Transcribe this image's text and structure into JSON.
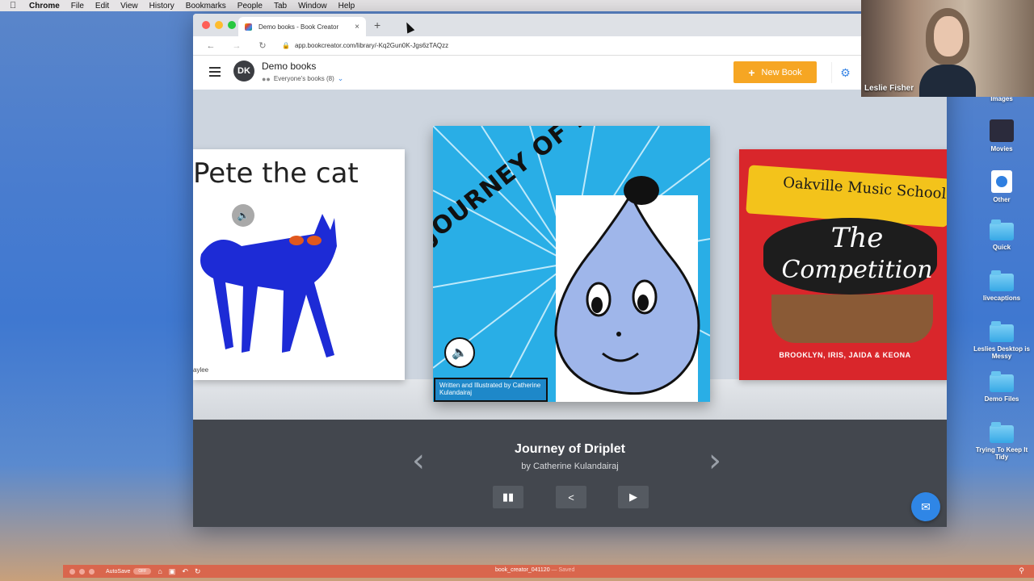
{
  "menubar": {
    "items": [
      "Chrome",
      "File",
      "Edit",
      "View",
      "History",
      "Bookmarks",
      "People",
      "Tab",
      "Window",
      "Help"
    ]
  },
  "desktop": {
    "icons": [
      {
        "label": "Images",
        "icon": "images-icon"
      },
      {
        "label": "Movies",
        "icon": "movies-thumbnail-icon"
      },
      {
        "label": "Other",
        "icon": "safari-file-icon"
      },
      {
        "label": "Quick",
        "icon": "folder-icon"
      },
      {
        "label": "livecaptions",
        "icon": "folder-icon"
      },
      {
        "label": "Leslies Desktop is Messy",
        "icon": "folder-icon"
      },
      {
        "label": "Demo Files",
        "icon": "folder-icon"
      },
      {
        "label": "Trying To Keep It Tidy",
        "icon": "folder-icon"
      }
    ]
  },
  "browser": {
    "tab_title": "Demo books - Book Creator",
    "url": "app.bookcreator.com/library/-Kq2Gun0K-Jgs6zTAQzz"
  },
  "app": {
    "avatar_initials": "DK",
    "library_title": "Demo books",
    "library_subtitle": "Everyone's books (8)",
    "new_book_label": "New Book",
    "accent": "#f6a623",
    "link_color": "#3a86e5"
  },
  "books": {
    "left": {
      "title": "Pete the cat",
      "author_fragment": "aylee"
    },
    "center": {
      "cover_title": "JOURNEY OF DRIPLET",
      "byline": "Written and Illustrated by Catherine Kulandairaj"
    },
    "right": {
      "banner": "Oakville Music School",
      "title_line1": "The",
      "title_line2": "Competition",
      "authors": "BROOKLYN, IRIS, JAIDA & KEONA"
    }
  },
  "selected": {
    "title": "Journey of Driplet",
    "author": "by Catherine Kulandairaj"
  },
  "webcam": {
    "name": "Leslie Fisher"
  },
  "taskbar": {
    "autosave": "AutoSave",
    "toggle": "OFF",
    "document": "book_creator_041120",
    "status": "— Saved"
  }
}
